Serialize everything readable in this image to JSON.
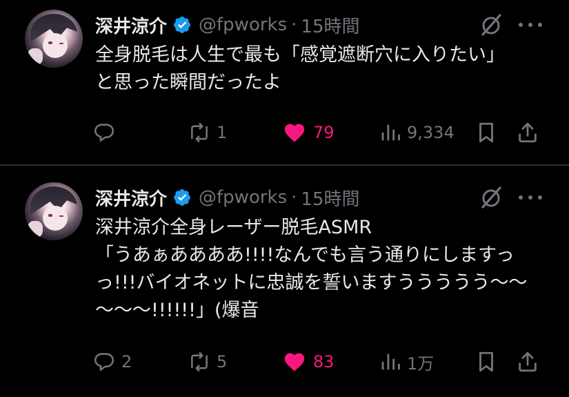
{
  "colors": {
    "background": "#000000",
    "text": "#e7e9ea",
    "muted": "#71767b",
    "verified": "#1d9bf0",
    "like": "#f91880"
  },
  "tweets": [
    {
      "author": {
        "display_name": "深井涼介",
        "handle": "@fpworks",
        "verified": true
      },
      "separator": "·",
      "time": "15時間",
      "text": "全身脱毛は人生で最も「感覚遮断穴に入りたい」\nと思った瞬間だったよ",
      "stats": {
        "replies": "",
        "retweets": "1",
        "likes": "79",
        "views": "9,334"
      },
      "liked": true
    },
    {
      "author": {
        "display_name": "深井涼介",
        "handle": "@fpworks",
        "verified": true
      },
      "separator": "·",
      "time": "15時間",
      "text": "深井涼介全身レーザー脱毛ASMR\n「うあぁああああ!!!!なんでも言う通りにしますっ\nっ!!!バイオネットに忠誠を誓いますううううう〜〜\n〜〜〜!!!!!!」(爆音",
      "stats": {
        "replies": "2",
        "retweets": "5",
        "likes": "83",
        "views": "1万"
      },
      "liked": true
    }
  ],
  "icons": {
    "verified": "verified-badge-icon",
    "grok": "grok-icon",
    "more": "more-icon",
    "reply": "reply-icon",
    "retweet": "retweet-icon",
    "like": "heart-icon",
    "views": "views-icon",
    "bookmark": "bookmark-icon",
    "share": "share-icon"
  }
}
